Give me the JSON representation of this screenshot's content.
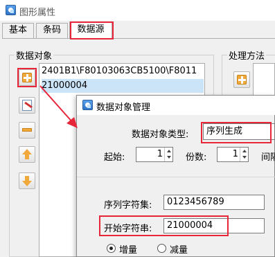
{
  "window": {
    "title": "图形属性"
  },
  "tabs": [
    "基本",
    "条码",
    "数据源"
  ],
  "data_group": {
    "label": "数据对象"
  },
  "proc_group": {
    "label": "处理方法"
  },
  "data_list": [
    "2401B1\\F80103063CB5100\\F8011",
    "21000004"
  ],
  "dialog": {
    "title": "数据对象管理",
    "type_label": "数据对象类型:",
    "type_value": "序列生成",
    "start_label": "起始:",
    "start_value": "1",
    "copies_label": "份数:",
    "copies_value": "1",
    "interval_label": "间隔",
    "charset_label": "序列字符集:",
    "charset_value": "0123456789",
    "startstr_label": "开始字符串:",
    "startstr_value": "21000004",
    "radio_increase": "增量",
    "radio_decrease": "减量"
  },
  "colors": {
    "highlight": "#e8263a",
    "selection": "#cce4f7",
    "accent": "#f0a93a"
  }
}
